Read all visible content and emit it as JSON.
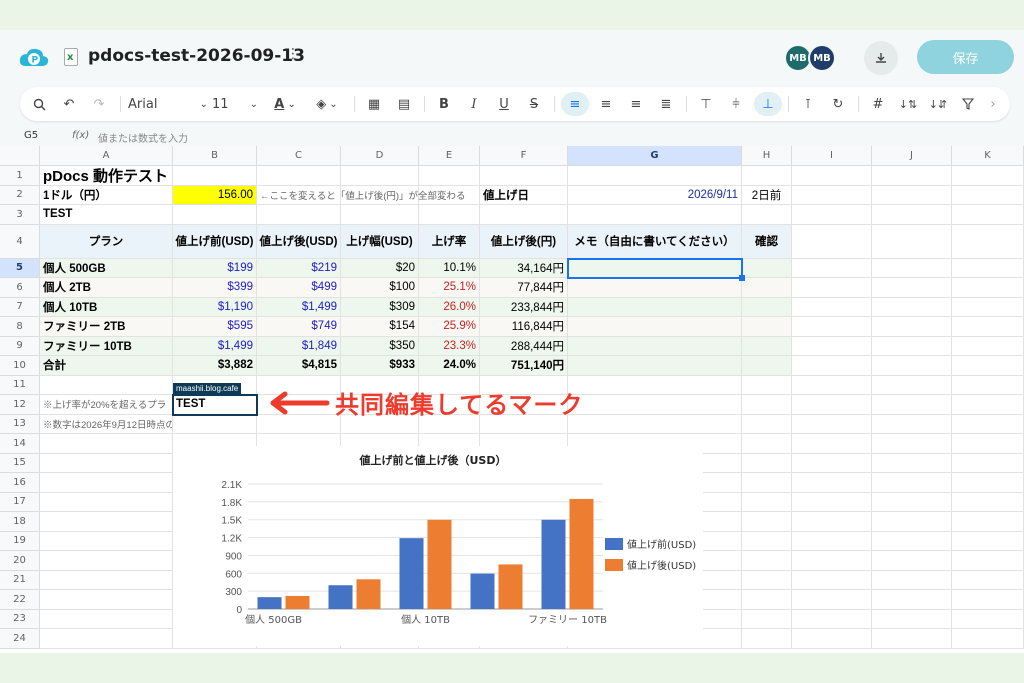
{
  "colors": {
    "accent": "#1a73e8",
    "save_button": "#8fd3de",
    "highlight_yellow": "#ffff00",
    "annotation_red": "#ee3b2e",
    "series1": "#4472c4",
    "series2": "#ed7d31"
  },
  "titlebar": {
    "doc_title": "pdocs-test-2026-09-13",
    "file_type_glyph": "x",
    "avatars": [
      "MB",
      "MB"
    ],
    "save_label": "保存"
  },
  "toolbar": {
    "font": "Arial",
    "font_size": "11",
    "font_color_glyph": "A"
  },
  "formula_bar": {
    "cell_ref": "G5",
    "fx": "f(x)",
    "placeholder": "値または数式を入力"
  },
  "sheet": {
    "columns": [
      "A",
      "B",
      "C",
      "D",
      "E",
      "F",
      "G",
      "H",
      "I",
      "J",
      "K"
    ],
    "rows": [
      "1",
      "2",
      "3",
      "4",
      "5",
      "6",
      "7",
      "8",
      "9",
      "10",
      "11",
      "12",
      "13",
      "14",
      "15",
      "16",
      "17",
      "18",
      "19",
      "20",
      "21",
      "22",
      "23",
      "24"
    ],
    "cells": {
      "a1": "pDocs 動作テスト",
      "a2": "1ドル（円）",
      "b2": "156.00",
      "c2": "←ここを変えると「値上げ後(円)」が全部変わる",
      "f2": "値上げ日",
      "g2": "2026/9/11",
      "h2": "2日前",
      "a3": "TEST",
      "headers": [
        "プラン",
        "値上げ前(USD)",
        "値上げ後(USD)",
        "上げ幅(USD)",
        "上げ率",
        "値上げ後(円)",
        "メモ（自由に書いてください）",
        "確認"
      ],
      "data_rows": [
        [
          "個人 500GB",
          "$199",
          "$219",
          "$20",
          "10.1%",
          "34,164円"
        ],
        [
          "個人 2TB",
          "$399",
          "$499",
          "$100",
          "25.1%",
          "77,844円"
        ],
        [
          "個人 10TB",
          "$1,190",
          "$1,499",
          "$309",
          "26.0%",
          "233,844円"
        ],
        [
          "ファミリー 2TB",
          "$595",
          "$749",
          "$154",
          "25.9%",
          "116,844円"
        ],
        [
          "ファミリー 10TB",
          "$1,499",
          "$1,849",
          "$350",
          "23.3%",
          "288,444円"
        ],
        [
          "合計",
          "$3,882",
          "$4,815",
          "$933",
          "24.0%",
          "751,140円"
        ]
      ],
      "a12": "※上げ率が20%を超えるプラ",
      "b12": "TEST",
      "a13": "※数字は2026年9月12日時点の"
    },
    "collab_user": "maashii.blog.cafe"
  },
  "annotation": "共同編集してるマーク",
  "chart_data": {
    "type": "bar",
    "title": "値上げ前と値上げ後（USD）",
    "categories": [
      "個人 500GB",
      "個人 2TB",
      "個人 10TB",
      "ファミリー 2TB",
      "ファミリー 10TB"
    ],
    "x_tick_labels": [
      "個人 500GB",
      "",
      "個人 10TB",
      "",
      "ファミリー 10TB"
    ],
    "series": [
      {
        "name": "値上げ前(USD)",
        "values": [
          199,
          399,
          1190,
          595,
          1499
        ],
        "color": "#4472c4"
      },
      {
        "name": "値上げ後(USD)",
        "values": [
          219,
          499,
          1499,
          749,
          1849
        ],
        "color": "#ed7d31"
      }
    ],
    "yticks": [
      "0",
      "300",
      "600",
      "900",
      "1.2K",
      "1.5K",
      "1.8K",
      "2.1K"
    ],
    "ylim": [
      0,
      2100
    ],
    "legend": "right",
    "grid": true
  }
}
